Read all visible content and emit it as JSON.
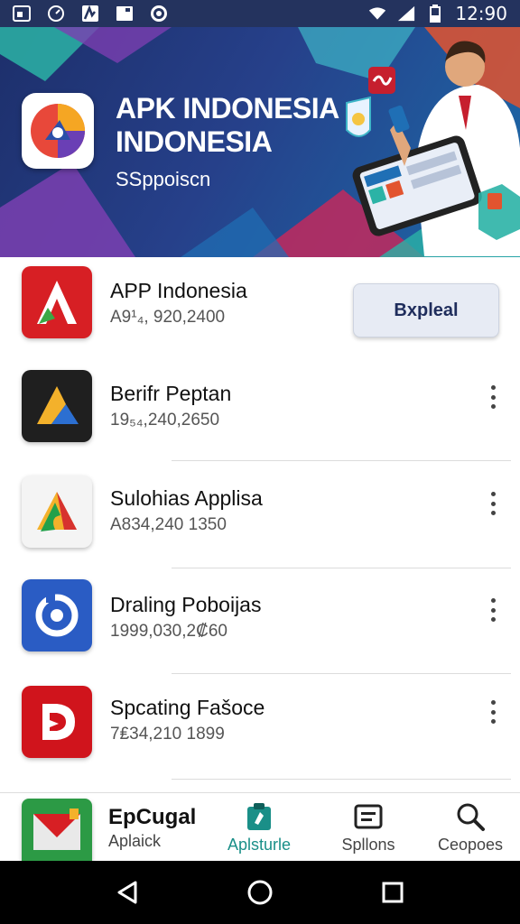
{
  "status_bar": {
    "time": "12:90",
    "icons": [
      "screenshot-icon",
      "speed-icon",
      "app-notification-icon",
      "image-icon",
      "sync-icon",
      "wifi-icon",
      "signal-icon",
      "battery-icon"
    ]
  },
  "hero": {
    "title_line1": "APK INDONESIA",
    "title_line2": "INDONESIA",
    "subtitle": "SSppoiscn"
  },
  "apps": [
    {
      "name": "APP Indonesia",
      "size": "A9¹₄, 920,2400",
      "action": "Bxpleal",
      "icon": "red-a-logo-icon"
    },
    {
      "name": "Berifr Peptan",
      "size": "19₅₄,240,2650",
      "icon": "dark-a-logo-icon"
    },
    {
      "name": "Sulohias Applisa",
      "size": "A834,240 1350",
      "icon": "green-a-logo-icon"
    },
    {
      "name": "Draling Poboĳas",
      "size": "1999,030,2₡60",
      "icon": "blue-ring-logo-icon"
    },
    {
      "name": "Spcating Fašoce",
      "size": "7₤34,210 1899",
      "icon": "red-d-logo-icon"
    }
  ],
  "bottom_nav": {
    "featured": {
      "title": "EpCugal",
      "label": "Aplaick"
    },
    "items": [
      {
        "label": "Aplsturle",
        "icon": "clipboard-icon",
        "active": true
      },
      {
        "label": "Spllons",
        "icon": "list-icon",
        "active": false
      },
      {
        "label": "Ceopoes",
        "icon": "search-icon",
        "active": false
      }
    ]
  },
  "system_nav": [
    "back-icon",
    "home-icon",
    "recents-icon"
  ],
  "colors": {
    "status_bar": "#24335e",
    "accent": "#1a8f88",
    "install_button": "#e7ebf4"
  }
}
